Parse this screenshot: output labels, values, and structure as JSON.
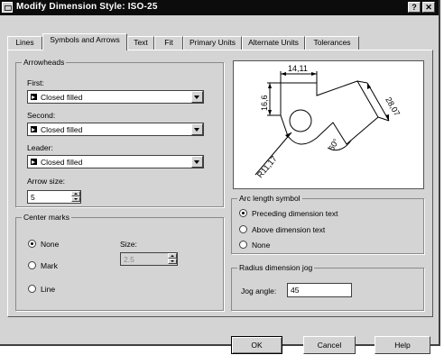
{
  "dialog": {
    "title": "Modify Dimension Style: ISO-25",
    "help_label": "?",
    "close_label": "✕"
  },
  "tabs": [
    {
      "label": "Lines"
    },
    {
      "label": "Symbols and Arrows"
    },
    {
      "label": "Text"
    },
    {
      "label": "Fit"
    },
    {
      "label": "Primary Units"
    },
    {
      "label": "Alternate Units"
    },
    {
      "label": "Tolerances"
    }
  ],
  "arrowheads": {
    "legend": "Arrowheads",
    "first_label": "First:",
    "first_value": "Closed filled",
    "second_label": "Second:",
    "second_value": "Closed filled",
    "leader_label": "Leader:",
    "leader_value": "Closed filled",
    "arrow_size_label": "Arrow size:",
    "arrow_size_value": "5"
  },
  "center_marks": {
    "legend": "Center marks",
    "none_label": "None",
    "mark_label": "Mark",
    "line_label": "Line",
    "size_label": "Size:",
    "size_value": "2.5",
    "selected": "None"
  },
  "preview": {
    "dims": {
      "top": "14,11",
      "left": "16,6",
      "right": "28,07",
      "angle": "60°",
      "radius": "R11,17"
    }
  },
  "arc_length": {
    "legend": "Arc length symbol",
    "options": [
      "Preceding dimension text",
      "Above dimension text",
      "None"
    ],
    "selected": "Preceding dimension text"
  },
  "radius_jog": {
    "legend": "Radius dimension jog",
    "jog_angle_label": "Jog angle:",
    "jog_angle_value": "45"
  },
  "buttons": {
    "ok": "OK",
    "cancel": "Cancel",
    "help": "Help"
  }
}
